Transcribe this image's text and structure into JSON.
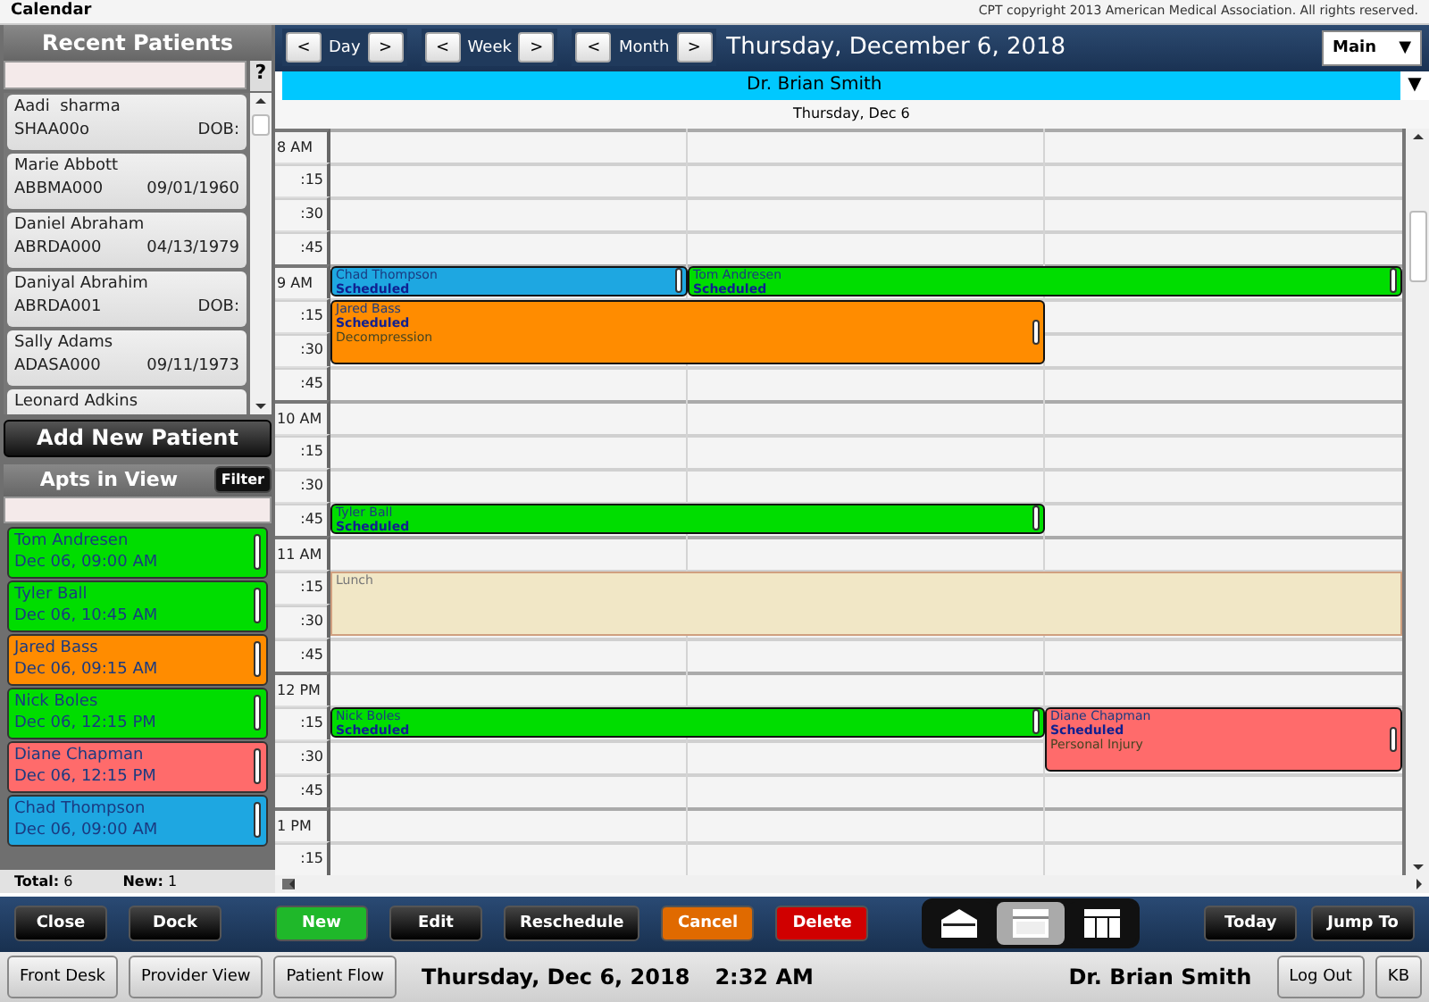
{
  "window": {
    "title": "Calendar",
    "copyright": "CPT copyright 2013 American Medical Association. All rights reserved."
  },
  "recent_patients": {
    "title": "Recent Patients",
    "help": "?",
    "patients": [
      {
        "name": "Aadi  sharma",
        "id": "SHAA00o",
        "dob": "DOB:"
      },
      {
        "name": "Marie Abbott",
        "id": "ABBMA000",
        "dob": "09/01/1960"
      },
      {
        "name": "Daniel Abraham",
        "id": "ABRDA000",
        "dob": "04/13/1979"
      },
      {
        "name": "Daniyal Abrahim",
        "id": "ABRDA001",
        "dob": "DOB:"
      },
      {
        "name": "Sally Adams",
        "id": "ADASA000",
        "dob": "09/11/1973"
      },
      {
        "name": "Leonard Adkins"
      }
    ],
    "add_button": "Add New Patient"
  },
  "apts_in_view": {
    "title": "Apts in View",
    "filter": "Filter",
    "items": [
      {
        "name": "Tom Andresen",
        "when": "Dec 06, 09:00 AM",
        "color": "#00dd00"
      },
      {
        "name": "Tyler Ball",
        "when": "Dec 06, 10:45 AM",
        "color": "#00dd00"
      },
      {
        "name": "Jared Bass",
        "when": "Dec 06, 09:15 AM",
        "color": "#ff8c00"
      },
      {
        "name": "Nick Boles",
        "when": "Dec 06, 12:15 PM",
        "color": "#00dd00"
      },
      {
        "name": "Diane Chapman",
        "when": "Dec 06, 12:15 PM",
        "color": "#ff6b6b"
      },
      {
        "name": "Chad Thompson",
        "when": "Dec 06, 09:00 AM",
        "color": "#1ea7e1"
      }
    ],
    "total": "**Total:** 6",
    "new": "**New:** 1"
  },
  "nav": {
    "groups": [
      {
        "prev": "<",
        "label": "Day",
        "next": ">"
      },
      {
        "prev": "<",
        "label": "Week",
        "next": ">"
      },
      {
        "prev": "<",
        "label": "Month",
        "next": ">"
      }
    ],
    "date": "Thursday, December 6, 2018",
    "view_menu": {
      "label": "Main",
      "caret": "▼"
    }
  },
  "provider": {
    "name": "Dr. Brian Smith",
    "caret": "▼"
  },
  "day_header": "Thursday, Dec 6",
  "time_slots": [
    {
      "label": "8 AM"
    },
    {
      "label": ":15"
    },
    {
      "label": ":30"
    },
    {
      "label": ":45"
    },
    {
      "label": "9 AM",
      "cells": [
        {
          "kind": "appointment",
          "name": "Chad Thompson",
          "status": "Scheduled",
          "color": "#1ea7e1"
        },
        {
          "kind": "appointment",
          "name": "Tom Andresen",
          "status": "Scheduled",
          "color": "#00dd00"
        },
        {
          "kind": "continued-right"
        }
      ]
    },
    {
      "label": ":15",
      "cells": [
        {
          "kind": "appointment",
          "name": "Jared Bass",
          "status": "Scheduled",
          "reason": "Decompression",
          "color": "#ff8c00"
        },
        {
          "kind": "continued-right"
        },
        {
          "kind": "empty"
        }
      ]
    },
    {
      "label": ":30",
      "cells": [
        {
          "kind": "continued-down"
        },
        {
          "kind": "continued-down"
        },
        {
          "kind": "empty"
        }
      ]
    },
    {
      "label": ":45"
    },
    {
      "label": "10 AM"
    },
    {
      "label": ":15"
    },
    {
      "label": ":30"
    },
    {
      "label": ":45",
      "cells": [
        {
          "kind": "appointment",
          "name": "Tyler Ball",
          "status": "Scheduled",
          "color": "#00dd00"
        },
        {
          "kind": "continued-right"
        },
        {
          "kind": "empty"
        }
      ]
    },
    {
      "label": "11 AM"
    },
    {
      "label": ":15",
      "cells": [
        {
          "kind": "block",
          "name": "Lunch",
          "color": "#f1e7c6"
        },
        {
          "kind": "continued-right"
        },
        {
          "kind": "continued-right"
        }
      ]
    },
    {
      "label": ":30",
      "cells": [
        {
          "kind": "continued-down"
        },
        {
          "kind": "continued-down"
        },
        {
          "kind": "continued-down"
        }
      ]
    },
    {
      "label": ":45"
    },
    {
      "label": "12 PM"
    },
    {
      "label": ":15",
      "cells": [
        {
          "kind": "appointment",
          "name": "Nick Boles",
          "status": "Scheduled",
          "color": "#00dd00"
        },
        {
          "kind": "continued-right"
        },
        {
          "kind": "appointment",
          "name": "Diane Chapman",
          "status": "Scheduled",
          "reason": "Personal Injury",
          "color": "#ff6b6b"
        }
      ]
    },
    {
      "label": ":30",
      "cells": [
        {
          "kind": "empty"
        },
        {
          "kind": "empty"
        },
        {
          "kind": "continued-down"
        }
      ]
    },
    {
      "label": ":45"
    },
    {
      "label": "1 PM"
    },
    {
      "label": ":15"
    }
  ],
  "toolbar": {
    "left": [
      {
        "label": "Close"
      },
      {
        "label": "Dock"
      }
    ],
    "actions": [
      {
        "label": "New",
        "color": "#1fb82a"
      },
      {
        "label": "Edit"
      },
      {
        "label": "Reschedule"
      },
      {
        "label": "Cancel",
        "color": "#e06a00"
      },
      {
        "label": "Delete",
        "color": "#d00000"
      }
    ],
    "views": [
      {
        "kind": "house",
        "selected": false
      },
      {
        "kind": "panel",
        "selected": true
      },
      {
        "kind": "columns",
        "selected": false
      }
    ],
    "right": [
      {
        "label": "Today"
      },
      {
        "label": "Jump To"
      }
    ]
  },
  "status_bar": {
    "left_buttons": [
      "Front Desk",
      "Provider View",
      "Patient Flow"
    ],
    "date": "Thursday, Dec 6, 2018",
    "time": "2:32 AM",
    "user": "Dr. Brian Smith",
    "right_buttons": [
      "Log Out",
      "KB"
    ]
  }
}
